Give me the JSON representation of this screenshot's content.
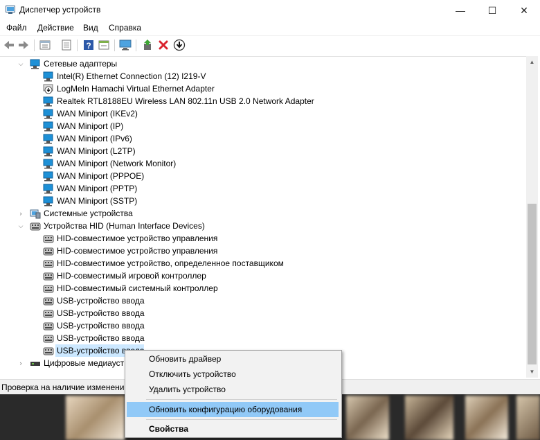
{
  "window": {
    "title": "Диспетчер устройств",
    "controls": {
      "minimize": "—",
      "maximize": "☐",
      "close": "✕"
    }
  },
  "menu": [
    "Файл",
    "Действие",
    "Вид",
    "Справка"
  ],
  "toolbar": {
    "icons": [
      "back-arrow-icon",
      "forward-arrow-icon",
      "properties-grid-icon",
      "properties-sheet-icon",
      "help-icon",
      "action-pane-icon",
      "monitor-icon",
      "update-driver-icon",
      "uninstall-x-icon",
      "disable-download-icon"
    ]
  },
  "tree": {
    "network": {
      "label": "Сетевые адаптеры",
      "children": [
        "Intel(R) Ethernet Connection (12) I219-V",
        "LogMeIn Hamachi Virtual Ethernet Adapter",
        "Realtek RTL8188EU Wireless LAN 802.11n USB 2.0 Network Adapter",
        "WAN Miniport (IKEv2)",
        "WAN Miniport (IP)",
        "WAN Miniport (IPv6)",
        "WAN Miniport (L2TP)",
        "WAN Miniport (Network Monitor)",
        "WAN Miniport (PPPOE)",
        "WAN Miniport (PPTP)",
        "WAN Miniport (SSTP)"
      ]
    },
    "system": {
      "label": "Системные устройства"
    },
    "hid": {
      "label": "Устройства HID (Human Interface Devices)",
      "children": [
        "HID-совместимое устройство управления",
        "HID-совместимое устройство управления",
        "HID-совместимое устройство, определенное поставщиком",
        "HID-совместимый игровой контроллер",
        "HID-совместимый системный контроллер",
        "USB-устройство ввода",
        "USB-устройство ввода",
        "USB-устройство ввода",
        "USB-устройство ввода",
        "USB-устройство ввода"
      ]
    },
    "digital_media": {
      "label": "Цифровые медиаустройства"
    }
  },
  "status": {
    "text": "Проверка на наличие изменени"
  },
  "context_menu": {
    "items": [
      "Обновить драйвер",
      "Отключить устройство",
      "Удалить устройство",
      "Обновить конфигурацию оборудования",
      "Свойства"
    ]
  },
  "colors": {
    "accent_network": "#1e90d6",
    "selection": "#cce8ff",
    "menu_highlight": "#91c9f7",
    "delete_red": "#d9232e"
  }
}
